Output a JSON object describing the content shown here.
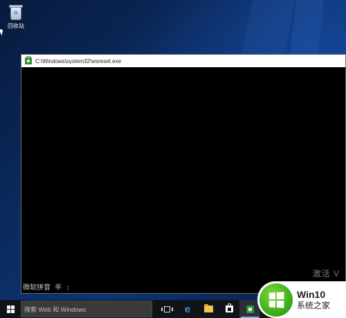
{
  "desktop": {
    "recycle_bin": {
      "label": "回收站",
      "icon": "recycle-bin-icon"
    }
  },
  "window": {
    "title": "C:\\Windows\\system32\\wsreset.exe",
    "icon": "store-app-icon",
    "ime_status": "微软拼音 半 :",
    "activate_watermark": "激活 V"
  },
  "taskbar": {
    "start_icon": "windows-start-icon",
    "search_placeholder": "搜索 Web 和 Windows",
    "icons": [
      "task-view-icon",
      "edge-icon",
      "file-explorer-icon",
      "store-icon",
      "wsreset-icon"
    ],
    "accent": "#7fb2e6"
  },
  "watermark_badge": {
    "title": "Win10",
    "subtitle": "系统之家",
    "logo_color": "#3fae1a"
  }
}
